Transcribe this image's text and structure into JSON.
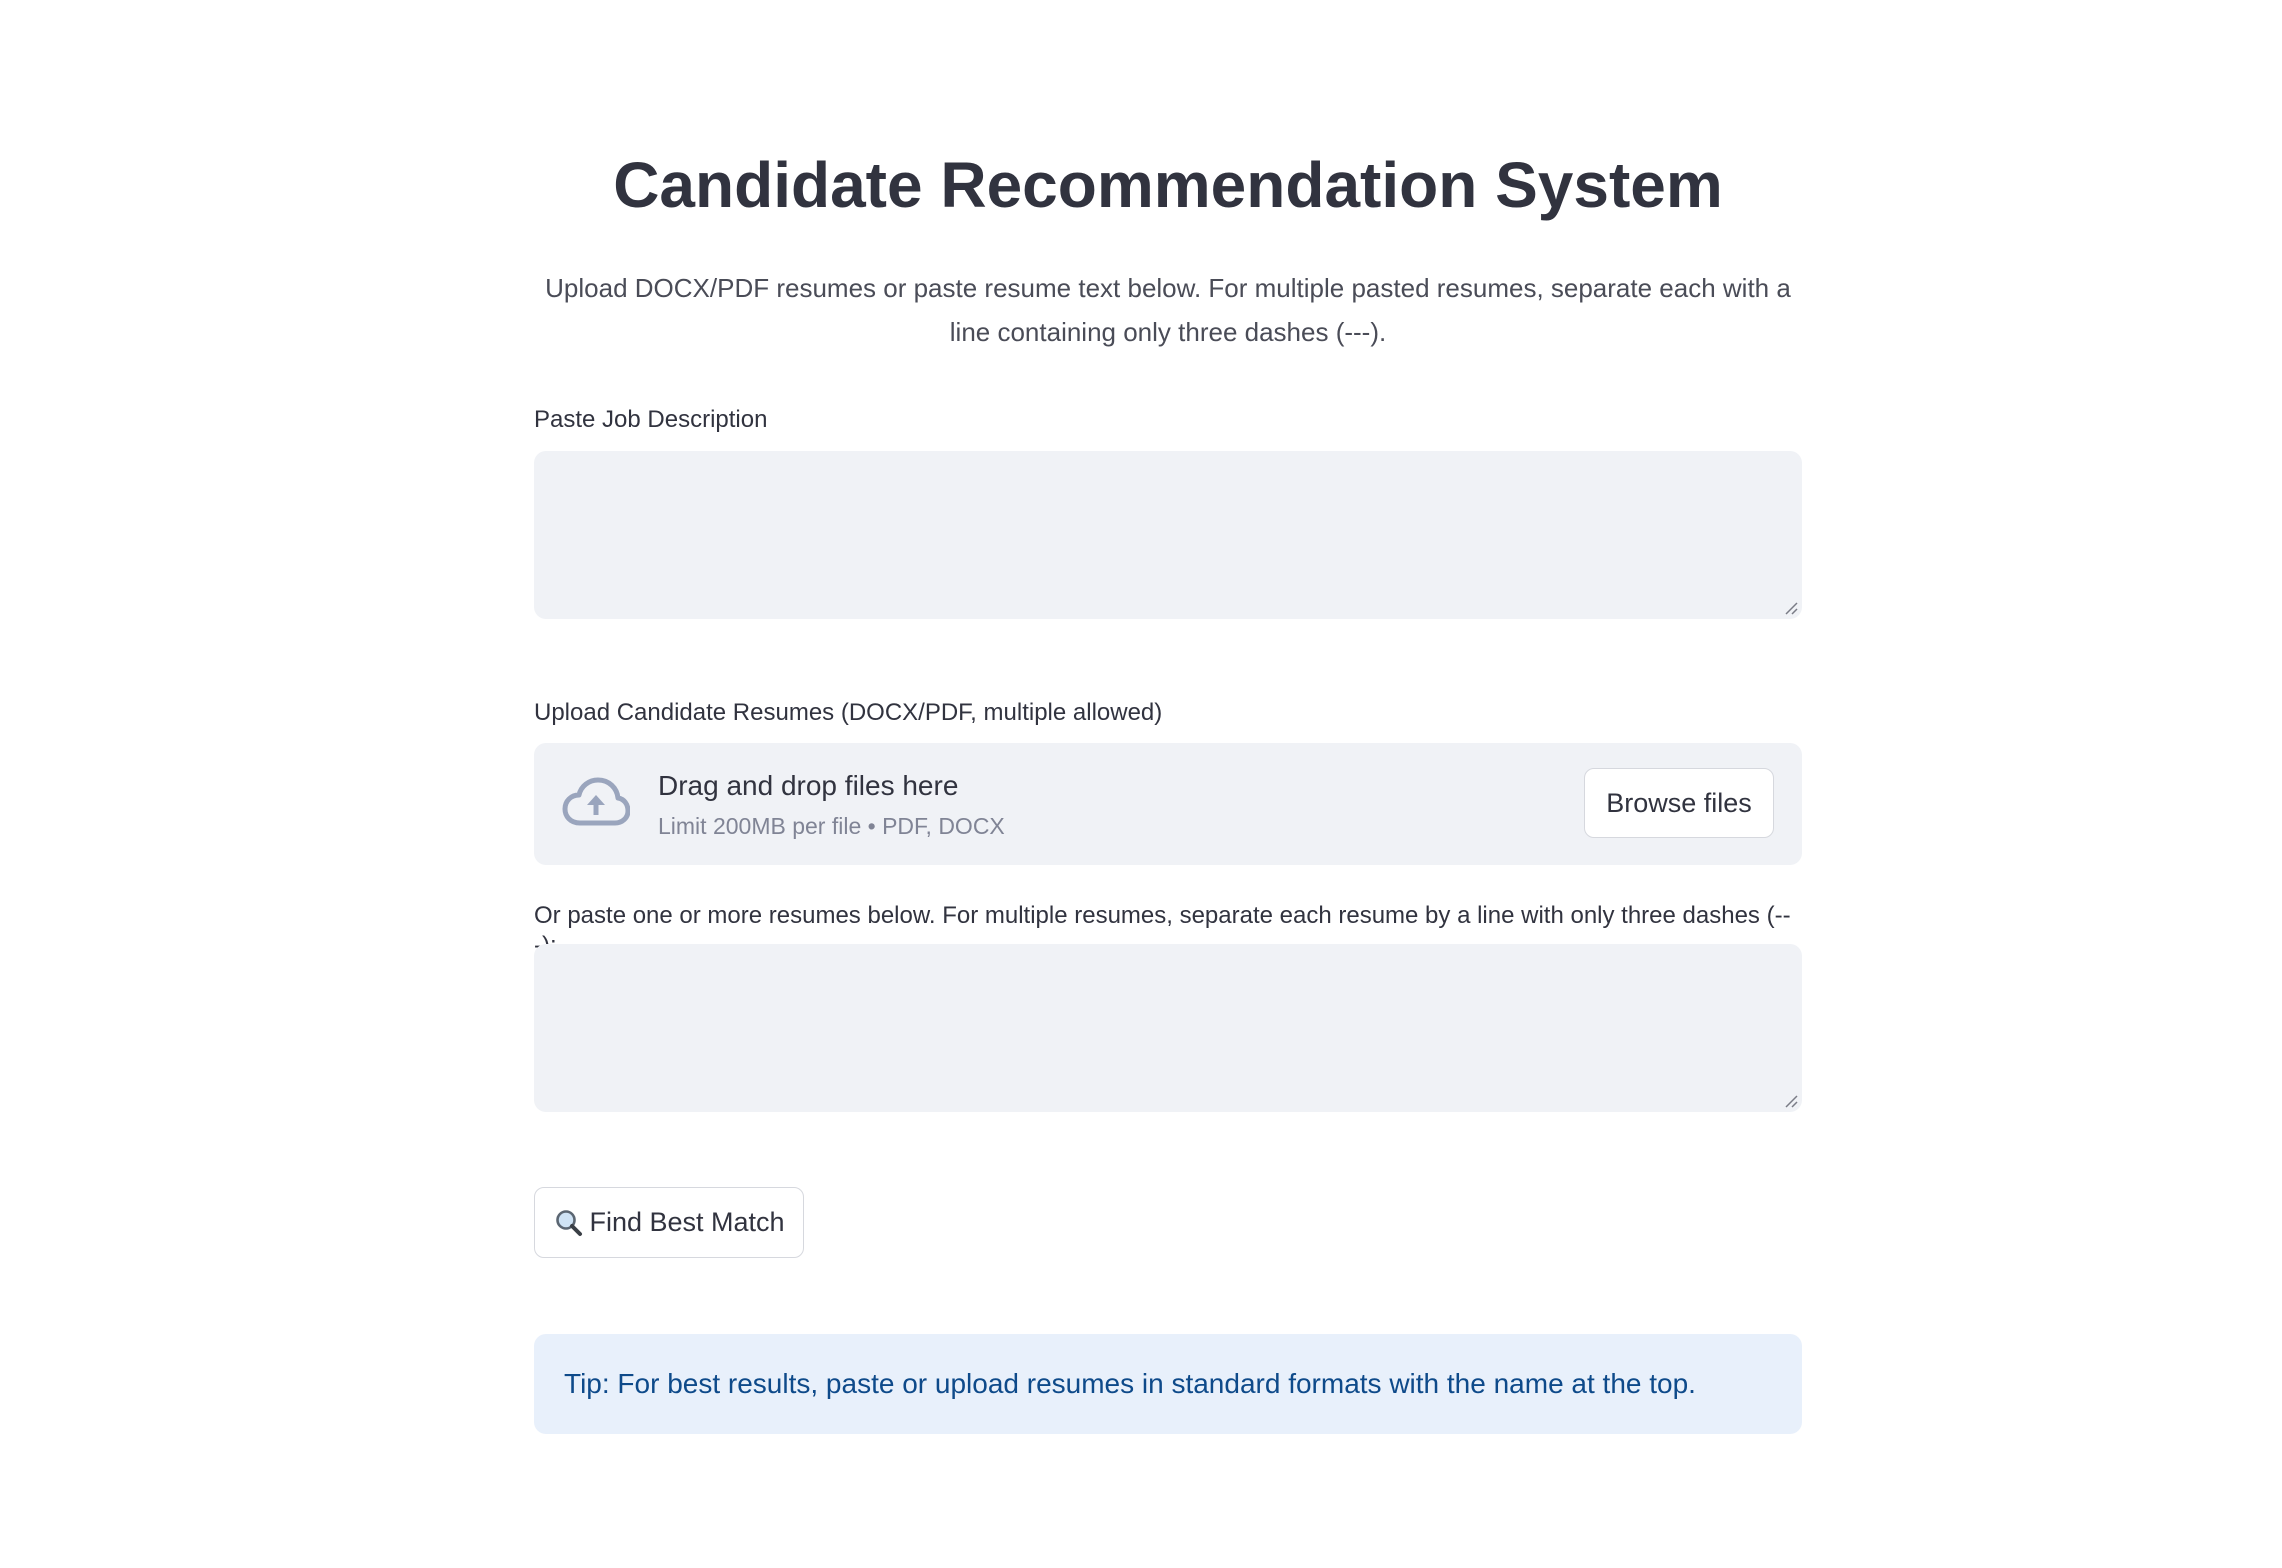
{
  "header": {
    "title": "Candidate Recommendation System",
    "subtitle": "Upload DOCX/PDF resumes or paste resume text below. For multiple pasted resumes, separate each with a line containing only three dashes (---)."
  },
  "job_description": {
    "label": "Paste Job Description",
    "value": ""
  },
  "uploader": {
    "label": "Upload Candidate Resumes (DOCX/PDF, multiple allowed)",
    "drop_title": "Drag and drop files here",
    "limit_text": "Limit 200MB per file • PDF, DOCX",
    "browse_label": "Browse files",
    "icon": "cloud-upload-icon"
  },
  "pasted_resumes": {
    "label": "Or paste one or more resumes below. For multiple resumes, separate each resume by a line with only three dashes (---):",
    "value": ""
  },
  "actions": {
    "find_label": "Find Best Match",
    "find_icon": "magnifier-icon"
  },
  "tip": {
    "text": "Tip: For best results, paste or upload resumes in standard formats with the name at the top."
  },
  "colors": {
    "input_bg": "#f0f2f6",
    "tip_bg": "#e8f0fb",
    "tip_text": "#0e4a8a",
    "icon": "#8f9bb3"
  }
}
